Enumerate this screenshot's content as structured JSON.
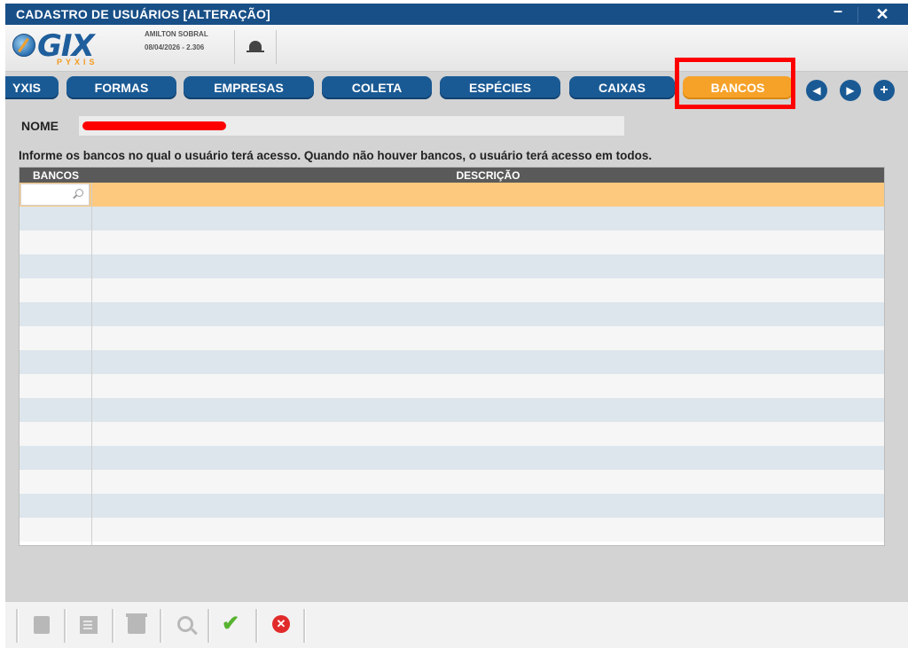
{
  "window": {
    "title": "CADASTRO DE USUÁRIOS  [ALTERAÇÃO]",
    "minimize_label": "–",
    "close_label": "✕"
  },
  "header": {
    "logo_text": "GIX",
    "logo_subtext": "PYXIS",
    "user_name": "AMILTON SOBRAL",
    "date_version": "08/04/2026 - 2.306",
    "bell_icon": "bell-icon"
  },
  "tabs": [
    {
      "label": "YXIS",
      "active": false
    },
    {
      "label": "FORMAS",
      "active": false
    },
    {
      "label": "EMPRESAS",
      "active": false
    },
    {
      "label": "COLETA",
      "active": false
    },
    {
      "label": "ESPÉCIES",
      "active": false
    },
    {
      "label": "CAIXAS",
      "active": false
    },
    {
      "label": "BANCOS",
      "active": true
    }
  ],
  "nav": {
    "prev_icon": "◀",
    "next_icon": "▶",
    "add_icon": "+"
  },
  "form": {
    "nome_label": "NOME",
    "nome_value": ""
  },
  "info_text": "Informe os bancos no qual o usuário terá acesso. Quando não houver bancos, o usuário terá acesso em todos.",
  "grid": {
    "col_bancos": "BANCOS",
    "col_descricao": "DESCRIÇÃO",
    "search_value": "",
    "rows_visible": 15
  },
  "toolbar": {
    "new_icon": "note-icon",
    "edit_icon": "edit-icon",
    "delete_icon": "trash-icon",
    "search_icon": "search-icon",
    "confirm_icon": "check-icon",
    "cancel_icon": "cancel-icon",
    "confirm_glyph": "✔",
    "cancel_glyph": "✕"
  },
  "colors": {
    "titlebar": "#184f87",
    "tab": "#1a5a94",
    "tab_active": "#f6a229",
    "selected_row": "#fdc97e",
    "highlight": "#ff0000"
  }
}
